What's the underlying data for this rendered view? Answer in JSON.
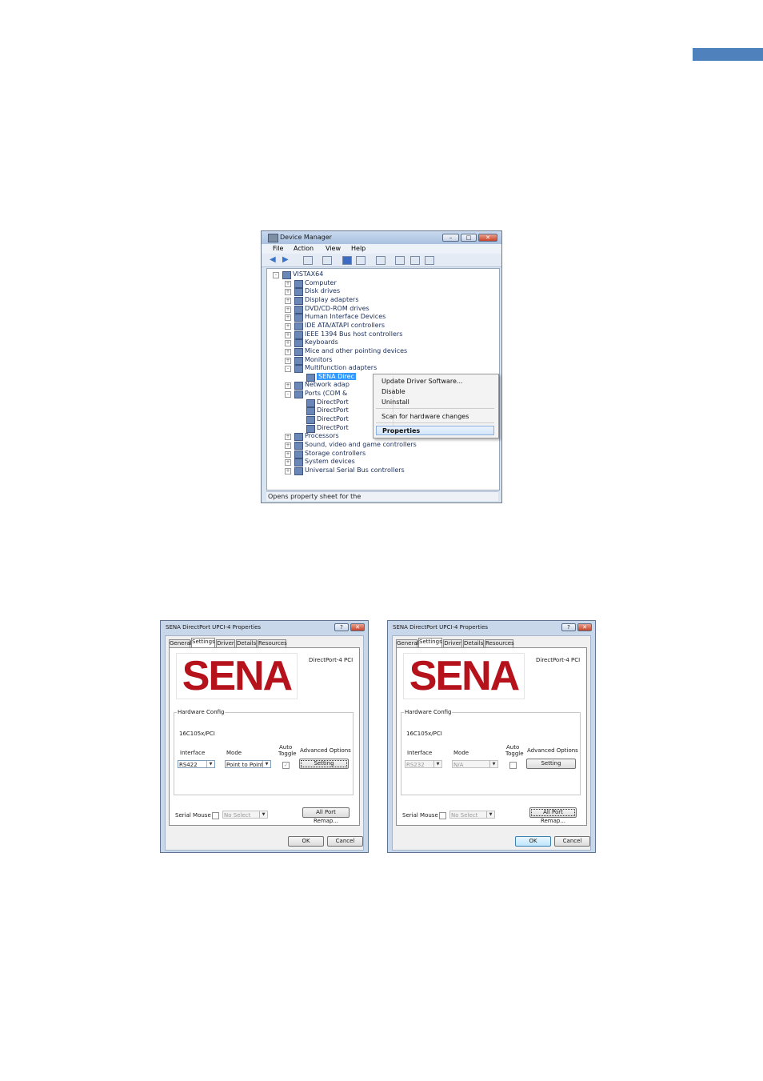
{
  "page": {
    "accent_color": "#4f81bd"
  },
  "device_manager": {
    "title": "Device Manager",
    "menu": [
      "File",
      "Action",
      "View",
      "Help"
    ],
    "tree": [
      {
        "label": "VISTAX64",
        "level": 0,
        "expander": "-"
      },
      {
        "label": "Computer",
        "level": 1,
        "expander": "+"
      },
      {
        "label": "Disk drives",
        "level": 1,
        "expander": "+"
      },
      {
        "label": "Display adapters",
        "level": 1,
        "expander": "+"
      },
      {
        "label": "DVD/CD-ROM drives",
        "level": 1,
        "expander": "+"
      },
      {
        "label": "Human Interface Devices",
        "level": 1,
        "expander": "+"
      },
      {
        "label": "IDE ATA/ATAPI controllers",
        "level": 1,
        "expander": "+"
      },
      {
        "label": "IEEE 1394 Bus host controllers",
        "level": 1,
        "expander": "+"
      },
      {
        "label": "Keyboards",
        "level": 1,
        "expander": "+"
      },
      {
        "label": "Mice and other pointing devices",
        "level": 1,
        "expander": "+"
      },
      {
        "label": "Monitors",
        "level": 1,
        "expander": "+"
      },
      {
        "label": "Multifunction adapters",
        "level": 1,
        "expander": "-"
      },
      {
        "label": "SENA Direc",
        "level": 2,
        "expander": "",
        "selected": true
      },
      {
        "label": "Network adap",
        "level": 1,
        "expander": "+"
      },
      {
        "label": "Ports (COM &",
        "level": 1,
        "expander": "-"
      },
      {
        "label": "DirectPort",
        "level": 2,
        "expander": ""
      },
      {
        "label": "DirectPort",
        "level": 2,
        "expander": ""
      },
      {
        "label": "DirectPort",
        "level": 2,
        "expander": ""
      },
      {
        "label": "DirectPort",
        "level": 2,
        "expander": ""
      },
      {
        "label": "Processors",
        "level": 1,
        "expander": "+"
      },
      {
        "label": "Sound, video and game controllers",
        "level": 1,
        "expander": "+"
      },
      {
        "label": "Storage controllers",
        "level": 1,
        "expander": "+"
      },
      {
        "label": "System devices",
        "level": 1,
        "expander": "+"
      },
      {
        "label": "Universal Serial Bus controllers",
        "level": 1,
        "expander": "+"
      }
    ],
    "context_menu": {
      "update_driver": "Update Driver Software...",
      "disable": "Disable",
      "uninstall": "Uninstall",
      "scan": "Scan for hardware changes",
      "properties": "Properties"
    },
    "status": "Opens property sheet for the"
  },
  "dialogs": [
    {
      "title": "SENA DirectPort UPCI-4 Properties",
      "tabs": [
        "General",
        "Settings",
        "Driver",
        "Details",
        "Resources"
      ],
      "active_tab": 1,
      "logo": "SENA",
      "model": "DirectPort-4 PCI",
      "group": "Hardware Config",
      "uart": "16C105x/PCI",
      "col_interface": "Interface",
      "col_mode": "Mode",
      "col_auto": "Auto",
      "col_toggle": "Toggle",
      "col_adv": "Advanced Options",
      "interface_value": "RS422",
      "mode_value": "Point to Point",
      "auto_checked": "✓",
      "setting_label": "Setting",
      "serial_mouse_label": "Serial Mouse :",
      "serial_mouse_value": "No Select",
      "remap_label": "All Port Remap...",
      "ok_label": "OK",
      "cancel_label": "Cancel",
      "controls_disabled": false
    },
    {
      "title": "SENA DirectPort UPCI-4 Properties",
      "tabs": [
        "General",
        "Settings",
        "Driver",
        "Details",
        "Resources"
      ],
      "active_tab": 1,
      "logo": "SENA",
      "model": "DirectPort-4 PCI",
      "group": "Hardware Config",
      "uart": "16C105x/PCI",
      "col_interface": "Interface",
      "col_mode": "Mode",
      "col_auto": "Auto",
      "col_toggle": "Toggle",
      "col_adv": "Advanced Options",
      "interface_value": "RS232",
      "mode_value": "N/A",
      "auto_checked": "",
      "setting_label": "Setting",
      "serial_mouse_label": "Serial Mouse :",
      "serial_mouse_value": "No Select",
      "remap_label": "All Port Remap...",
      "ok_label": "OK",
      "cancel_label": "Cancel",
      "controls_disabled": true
    }
  ]
}
